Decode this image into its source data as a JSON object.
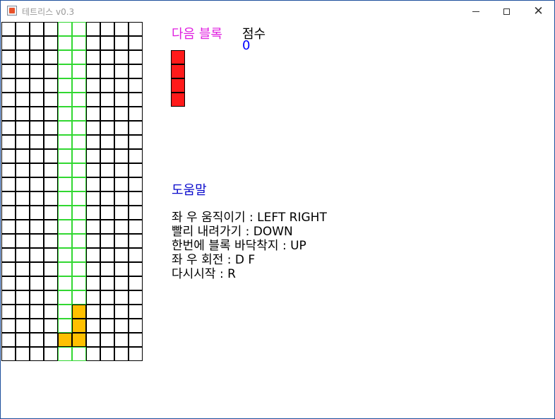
{
  "window": {
    "title": "테트리스 v0.3",
    "close_glyph": "✕"
  },
  "board": {
    "columns": 10,
    "rows": 24,
    "ghost_columns": [
      4,
      5
    ],
    "placed_cells": [
      [
        5,
        20
      ],
      [
        5,
        21
      ],
      [
        4,
        22
      ],
      [
        5,
        22
      ]
    ],
    "colors": {
      "grid": "#000000",
      "ghost": "#32d732",
      "placed": "#ffc000"
    }
  },
  "next_block": {
    "label": "다음 블록",
    "cells": [
      [
        0,
        0
      ],
      [
        0,
        1
      ],
      [
        0,
        2
      ],
      [
        0,
        3
      ]
    ],
    "color": "#ff1a1a"
  },
  "score": {
    "label": "점수",
    "value": "0"
  },
  "help": {
    "title": "도움말",
    "lines": [
      "좌 우 움직이기 : LEFT RIGHT",
      "빨리 내려가기 : DOWN",
      "한번에 블록 바닥착지 : UP",
      "좌 우 회전 : D F",
      "다시시작 : R"
    ]
  }
}
